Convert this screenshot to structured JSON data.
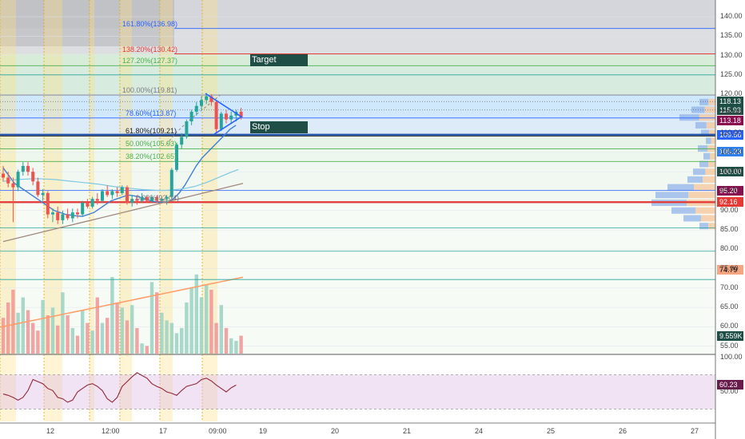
{
  "chart_data": {
    "type": "candlestick",
    "price_axis": {
      "ticks": [
        "140.00",
        "135.00",
        "130.00",
        "125.00",
        "120.00",
        "115.00",
        "110.00",
        "105.00",
        "100.00",
        "95.00",
        "90.00",
        "85.00",
        "80.00",
        "75.00",
        "70.00",
        "65.00",
        "60.00",
        "55.00"
      ]
    },
    "time_axis": {
      "ticks": [
        "12",
        "12:00",
        "17",
        "09:00",
        "19",
        "20",
        "21",
        "24",
        "25",
        "26",
        "27"
      ]
    },
    "oscillator_axis": {
      "ticks": [
        "100.00",
        "50.00"
      ],
      "upper": 75,
      "lower": 25
    },
    "fib_levels": [
      {
        "label": "161.80%(136.98)",
        "price": 136.98,
        "color": "#2962ff"
      },
      {
        "label": "138.20%(130.42)",
        "price": 130.42,
        "color": "#e53935"
      },
      {
        "label": "127.20%(127.37)",
        "price": 127.37,
        "color": "#4caf50"
      },
      {
        "label": "100.00%(119.81)",
        "price": 119.81,
        "color": "#787b86"
      },
      {
        "label": "78.60%(113.87)",
        "price": 113.87,
        "color": "#2962ff"
      },
      {
        "label": "61.80%(109.21)",
        "price": 109.21,
        "color": "#222222"
      },
      {
        "label": "50.00%(105.93)",
        "price": 105.93,
        "color": "#4caf50"
      },
      {
        "label": "38.20%(102.65)",
        "price": 102.65,
        "color": "#4caf50"
      },
      {
        "label": "0.00%(92.04)",
        "price": 92.04,
        "color": "#787b86"
      }
    ],
    "annotations": {
      "target": "Target",
      "stop": "Stop"
    },
    "price_badges": [
      {
        "text": "118.13",
        "price": 118.13,
        "bg": "#1f4e46",
        "fg": "#ffffff"
      },
      {
        "text": "115.93",
        "price": 115.93,
        "bg": "#1f4e46",
        "fg": "#ffffff"
      },
      {
        "text": "113.18",
        "price": 113.18,
        "bg": "#880e4f",
        "fg": "#ffffff"
      },
      {
        "text": "109.56",
        "price": 109.56,
        "bg": "#2962ff",
        "fg": "#ffffff"
      },
      {
        "text": "105.23",
        "price": 105.23,
        "bg": "#2f80ed",
        "fg": "#ffffff"
      },
      {
        "text": "100.00",
        "price": 100.0,
        "bg": "#1f4e46",
        "fg": "#ffffff"
      },
      {
        "text": "95.20",
        "price": 95.2,
        "bg": "#880e4f",
        "fg": "#ffffff"
      },
      {
        "text": "92.16",
        "price": 92.16,
        "bg": "#e53935",
        "fg": "#ffffff"
      },
      {
        "text": "74.79",
        "price": 74.79,
        "bg": "#f4a582",
        "fg": "#000000"
      },
      {
        "text": "9.559K",
        "price": 57.6,
        "bg": "#1f4e46",
        "fg": "#ffffff"
      }
    ],
    "oscillator_badge": {
      "text": "60.23",
      "value": 60.23
    },
    "candles": [
      {
        "o": 99.5,
        "h": 101.5,
        "l": 97.5,
        "c": 98.5
      },
      {
        "o": 98.5,
        "h": 100.0,
        "l": 96.0,
        "c": 97.0
      },
      {
        "o": 97.0,
        "h": 98.5,
        "l": 87.0,
        "c": 96.0
      },
      {
        "o": 96.0,
        "h": 100.5,
        "l": 95.0,
        "c": 100.0
      },
      {
        "o": 100.0,
        "h": 102.5,
        "l": 99.0,
        "c": 101.5
      },
      {
        "o": 101.5,
        "h": 102.5,
        "l": 99.0,
        "c": 100.0
      },
      {
        "o": 100.0,
        "h": 101.0,
        "l": 96.5,
        "c": 97.5
      },
      {
        "o": 97.5,
        "h": 98.5,
        "l": 93.5,
        "c": 94.0
      },
      {
        "o": 94.0,
        "h": 95.5,
        "l": 92.5,
        "c": 94.5
      },
      {
        "o": 94.5,
        "h": 95.0,
        "l": 88.0,
        "c": 89.0
      },
      {
        "o": 89.0,
        "h": 90.5,
        "l": 87.0,
        "c": 89.5
      },
      {
        "o": 89.5,
        "h": 91.0,
        "l": 86.5,
        "c": 87.5
      },
      {
        "o": 87.5,
        "h": 90.0,
        "l": 86.5,
        "c": 89.0
      },
      {
        "o": 89.0,
        "h": 90.5,
        "l": 87.5,
        "c": 88.0
      },
      {
        "o": 88.0,
        "h": 90.5,
        "l": 87.0,
        "c": 89.5
      },
      {
        "o": 89.5,
        "h": 90.5,
        "l": 88.0,
        "c": 89.0
      },
      {
        "o": 89.0,
        "h": 92.5,
        "l": 88.5,
        "c": 92.0
      },
      {
        "o": 92.0,
        "h": 93.0,
        "l": 90.5,
        "c": 91.0
      },
      {
        "o": 91.0,
        "h": 93.5,
        "l": 90.5,
        "c": 93.0
      },
      {
        "o": 93.0,
        "h": 94.5,
        "l": 91.5,
        "c": 92.5
      },
      {
        "o": 92.5,
        "h": 95.5,
        "l": 92.0,
        "c": 95.0
      },
      {
        "o": 95.0,
        "h": 96.5,
        "l": 93.5,
        "c": 94.0
      },
      {
        "o": 94.0,
        "h": 95.5,
        "l": 93.0,
        "c": 95.0
      },
      {
        "o": 95.0,
        "h": 96.0,
        "l": 93.5,
        "c": 94.5
      },
      {
        "o": 94.5,
        "h": 96.5,
        "l": 94.0,
        "c": 96.0
      },
      {
        "o": 96.0,
        "h": 96.5,
        "l": 91.5,
        "c": 92.0
      },
      {
        "o": 92.0,
        "h": 94.0,
        "l": 91.0,
        "c": 93.0
      },
      {
        "o": 93.0,
        "h": 94.0,
        "l": 91.5,
        "c": 92.5
      },
      {
        "o": 92.5,
        "h": 94.5,
        "l": 92.0,
        "c": 93.5
      },
      {
        "o": 93.5,
        "h": 94.0,
        "l": 92.0,
        "c": 92.5
      },
      {
        "o": 92.5,
        "h": 94.0,
        "l": 92.0,
        "c": 93.5
      },
      {
        "o": 93.5,
        "h": 94.0,
        "l": 92.0,
        "c": 92.5
      },
      {
        "o": 92.5,
        "h": 93.5,
        "l": 92.0,
        "c": 93.0
      },
      {
        "o": 93.0,
        "h": 94.0,
        "l": 91.5,
        "c": 93.5
      },
      {
        "o": 93.5,
        "h": 101.0,
        "l": 93.0,
        "c": 100.5
      },
      {
        "o": 100.5,
        "h": 107.5,
        "l": 100.0,
        "c": 107.0
      },
      {
        "o": 107.0,
        "h": 110.0,
        "l": 106.0,
        "c": 109.0
      },
      {
        "o": 109.0,
        "h": 113.5,
        "l": 108.5,
        "c": 113.0
      },
      {
        "o": 113.0,
        "h": 116.0,
        "l": 112.0,
        "c": 115.5
      },
      {
        "o": 115.5,
        "h": 118.0,
        "l": 114.5,
        "c": 117.0
      },
      {
        "o": 117.0,
        "h": 119.5,
        "l": 116.0,
        "c": 118.5
      },
      {
        "o": 118.5,
        "h": 120.3,
        "l": 117.5,
        "c": 119.5
      },
      {
        "o": 119.5,
        "h": 120.0,
        "l": 117.0,
        "c": 118.0
      },
      {
        "o": 118.0,
        "h": 118.5,
        "l": 110.0,
        "c": 111.0
      },
      {
        "o": 111.0,
        "h": 115.5,
        "l": 110.5,
        "c": 115.0
      },
      {
        "o": 115.0,
        "h": 116.0,
        "l": 112.5,
        "c": 113.5
      },
      {
        "o": 113.5,
        "h": 115.5,
        "l": 112.5,
        "c": 114.5
      },
      {
        "o": 114.5,
        "h": 116.0,
        "l": 113.0,
        "c": 115.5
      },
      {
        "o": 115.5,
        "h": 116.5,
        "l": 113.5,
        "c": 114.0
      }
    ],
    "volumes": [
      14,
      20,
      25,
      16,
      22,
      17,
      12,
      9,
      21,
      15,
      18,
      11,
      24,
      15,
      10,
      7,
      17,
      12,
      9,
      22,
      12,
      14,
      30,
      20,
      18,
      13,
      19,
      10,
      4,
      3,
      28,
      24,
      16,
      13,
      12,
      8,
      10,
      20,
      26,
      31,
      22,
      27,
      25,
      12,
      19,
      10,
      6,
      5,
      7
    ],
    "oscillator": [
      47,
      45,
      42,
      38,
      42,
      52,
      68,
      65,
      62,
      55,
      52,
      42,
      40,
      35,
      38,
      50,
      55,
      60,
      62,
      58,
      52,
      40,
      35,
      42,
      58,
      65,
      72,
      78,
      74,
      70,
      62,
      58,
      55,
      50,
      48,
      45,
      52,
      58,
      60,
      62,
      68,
      70,
      66,
      60,
      55,
      50,
      56,
      60
    ],
    "ma_fast": [
      101,
      99,
      97,
      96,
      95,
      94,
      93,
      92,
      91,
      90,
      89.5,
      89,
      88.8,
      88.6,
      88.5,
      89,
      89.5,
      90.5,
      91.5,
      92.5,
      93,
      93.5,
      94,
      93.8,
      93.5,
      93,
      92.5,
      92.2,
      92.1,
      92.3,
      93,
      94.5,
      96.5,
      99,
      101.5,
      103.5,
      105,
      106.5,
      108,
      109.5,
      111,
      112
    ],
    "ma_mid": [
      97.5,
      97.8,
      98,
      98.1,
      98.2,
      98.2,
      98.1,
      98,
      97.8,
      97.6,
      97.4,
      97.2,
      97,
      96.8,
      96.5,
      96.2,
      96,
      95.8,
      95.6,
      95.4,
      95.3,
      95.2,
      95.2,
      95.3,
      95.5,
      95.8,
      96.2,
      96.8,
      97.5,
      98.3,
      99.1,
      99.9,
      100.6
    ],
    "ma_slow": [
      82,
      83,
      84,
      85,
      86,
      87,
      88,
      89,
      90,
      91,
      92,
      93,
      94,
      95,
      96,
      97
    ],
    "vol_ma": [
      10,
      11,
      12,
      13,
      14,
      15,
      16,
      17,
      18,
      19,
      20,
      21,
      22,
      23,
      24,
      25,
      26,
      27,
      28,
      29
    ]
  }
}
